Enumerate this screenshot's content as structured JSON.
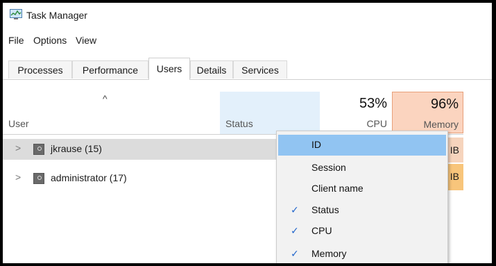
{
  "window": {
    "title": "Task Manager"
  },
  "menubar": {
    "items": [
      "File",
      "Options",
      "View"
    ]
  },
  "tabs": [
    {
      "label": "Processes",
      "active": false
    },
    {
      "label": "Performance",
      "active": false
    },
    {
      "label": "Users",
      "active": true
    },
    {
      "label": "Details",
      "active": false
    },
    {
      "label": "Services",
      "active": false
    }
  ],
  "table": {
    "sort_indicator": "^",
    "columns": {
      "user": "User",
      "status": "Status",
      "cpu": {
        "label": "CPU",
        "percent": "53%"
      },
      "memory": {
        "label": "Memory",
        "percent": "96%"
      }
    },
    "rows": [
      {
        "expander": ">",
        "name": "jkrause (15)",
        "memory_partial": "IB",
        "selected": true
      },
      {
        "expander": ">",
        "name": "administrator (17)",
        "memory_partial": "IB",
        "selected": false
      }
    ]
  },
  "context_menu": {
    "items": [
      {
        "label": "ID",
        "checked": false,
        "highlighted": true
      },
      {
        "label": "Session",
        "checked": false,
        "highlighted": false
      },
      {
        "label": "Client name",
        "checked": false,
        "highlighted": false
      },
      {
        "label": "Status",
        "checked": true,
        "highlighted": false
      },
      {
        "label": "CPU",
        "checked": true,
        "highlighted": false
      },
      {
        "label": "Memory",
        "checked": true,
        "highlighted": false
      }
    ],
    "check_glyph": "✓"
  },
  "colors": {
    "status_header_bg": "#e3f0fb",
    "memory_header_bg": "#fbd4bf",
    "memory_row_1_bg": "#f6d4bd",
    "memory_row_2_bg": "#f8c57b",
    "menu_highlight": "#91c4f2",
    "selected_row_bg": "#dcdcdc"
  },
  "icons": {
    "app": "task-manager-icon",
    "user": "user-icon",
    "expander": "chevron-right-icon",
    "check": "checkmark-icon"
  }
}
